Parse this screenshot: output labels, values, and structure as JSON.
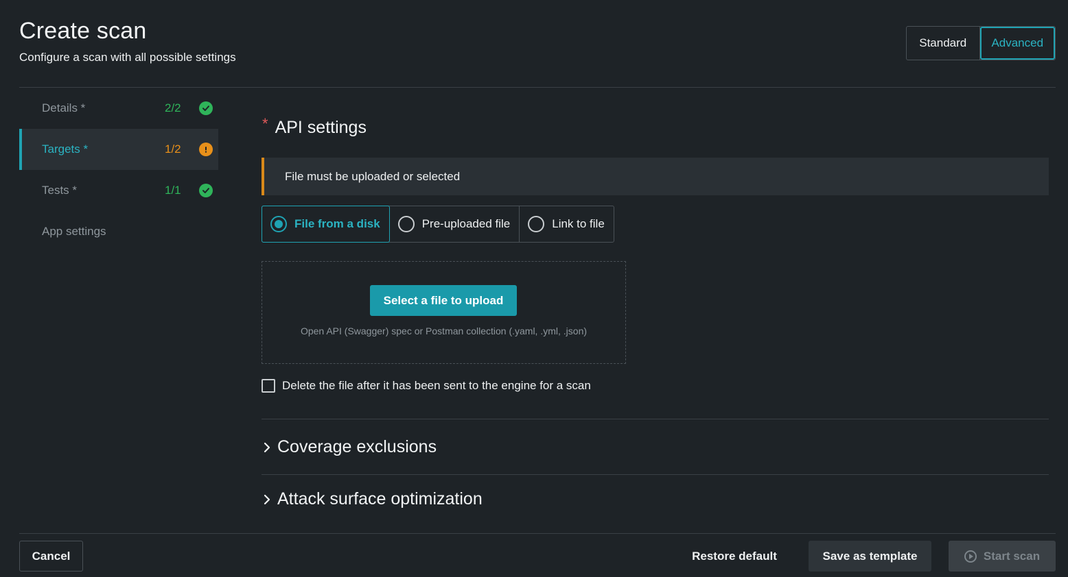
{
  "header": {
    "title": "Create scan",
    "subtitle": "Configure a scan with all possible settings",
    "modes": [
      {
        "label": "Standard",
        "active": false
      },
      {
        "label": "Advanced",
        "active": true
      }
    ]
  },
  "sidebar": {
    "items": [
      {
        "label": "Details *",
        "count": "2/2",
        "status": "complete",
        "active": false
      },
      {
        "label": "Targets *",
        "count": "1/2",
        "status": "warning",
        "active": true
      },
      {
        "label": "Tests *",
        "count": "1/1",
        "status": "complete",
        "active": false
      },
      {
        "label": "App settings",
        "count": "",
        "status": "",
        "active": false
      }
    ]
  },
  "main": {
    "section_required_mark": "*",
    "section_title": "API settings",
    "alert_text": "File must be uploaded or selected",
    "source_options": [
      {
        "label": "File from a disk",
        "selected": true
      },
      {
        "label": "Pre-uploaded file",
        "selected": false
      },
      {
        "label": "Link to file",
        "selected": false
      }
    ],
    "upload_button": "Select a file to upload",
    "upload_hint": "Open API (Swagger) spec or Postman collection (.yaml, .yml, .json)",
    "delete_file_label": "Delete the file after it has been sent to the engine for a scan",
    "delete_file_checked": false,
    "collapsibles": [
      {
        "label": "Coverage exclusions",
        "expanded": false
      },
      {
        "label": "Attack surface optimization",
        "expanded": false
      }
    ]
  },
  "footer": {
    "cancel": "Cancel",
    "restore_default": "Restore default",
    "save_as_template": "Save as template",
    "start_scan": "Start scan",
    "start_scan_disabled": true
  },
  "colors": {
    "background": "#1e2327",
    "accent": "#1fa3b3",
    "success": "#2fb45a",
    "warning": "#e8901a",
    "required": "#e05a5a"
  }
}
